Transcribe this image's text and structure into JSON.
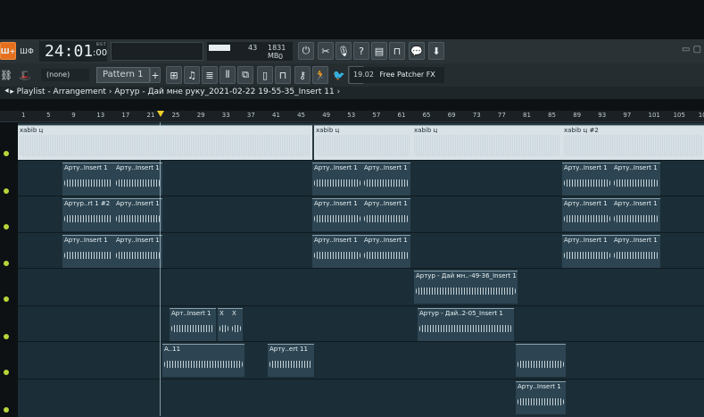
{
  "toolbar": {
    "fl_badge": "Ш+",
    "mode_label": "ШФ",
    "time_main": "24:01",
    "time_sub": ":00",
    "time_unit": "B:S:T",
    "cpu_value": "43",
    "memory": "1831 MB",
    "poly_value": "0",
    "pattern_label": "Pattern 1",
    "none_label": "(none)",
    "hint_code": "19.02",
    "hint_text": "Free Patcher FX"
  },
  "title": {
    "playlist_label": "Playlist - Arrangement",
    "arrow": "›",
    "song_name": "Артур - Дай мне руку_2021-02-22 19-55-35_Insert 11",
    "end_arrow": "›"
  },
  "ruler": {
    "marks": [
      "1",
      "5",
      "9",
      "13",
      "17",
      "21",
      "25",
      "29",
      "33",
      "37",
      "41",
      "45",
      "49",
      "53",
      "57",
      "61",
      "65",
      "69",
      "73",
      "77",
      "81",
      "85",
      "89",
      "93",
      "97",
      "101",
      "105",
      "109"
    ]
  },
  "tracks": [
    {
      "clips": [
        {
          "label": "xabib ц"
        },
        {
          "label": "xabib ц"
        },
        {
          "label": "xabib ц"
        },
        {
          "label": "xabib ц #2"
        }
      ]
    },
    {
      "clips": [
        {
          "label": "Арту..Insert 1"
        },
        {
          "label": "Арту..Insert 1"
        },
        {
          "label": "Арту..Insert 1"
        },
        {
          "label": "Арту..Insert 1"
        },
        {
          "label": "Арту..Insert 1"
        },
        {
          "label": "Арту..Insert 1"
        }
      ]
    },
    {
      "clips": [
        {
          "label": "Артур..rt 1 #2"
        },
        {
          "label": "Арту..Insert 1"
        },
        {
          "label": "Арту..Insert 1"
        },
        {
          "label": "Арту..Insert 1"
        },
        {
          "label": "Арту..Insert 1"
        },
        {
          "label": "Арту..Insert 1"
        }
      ]
    },
    {
      "clips": [
        {
          "label": "Арту..Insert 1"
        },
        {
          "label": "Арту..Insert 1"
        },
        {
          "label": "Арту..Insert 1"
        },
        {
          "label": "Арту..Insert 1"
        },
        {
          "label": "Арту..Insert 1"
        },
        {
          "label": "Арту..Insert 1"
        }
      ]
    },
    {
      "clips": [
        {
          "label": "Артур - Дай мн..-49-36_Insert 1"
        }
      ]
    },
    {
      "clips": [
        {
          "label": "Арт..Insert 1"
        },
        {
          "label": "X"
        },
        {
          "label": "X"
        },
        {
          "label": "Артур - Дай..2-05_Insert 1"
        }
      ]
    },
    {
      "clips": [
        {
          "label": "A..11"
        },
        {
          "label": "Арту..ert 11"
        },
        {
          "label": ""
        }
      ]
    },
    {
      "clips": [
        {
          "label": "Арту..Insert 1"
        }
      ]
    }
  ]
}
